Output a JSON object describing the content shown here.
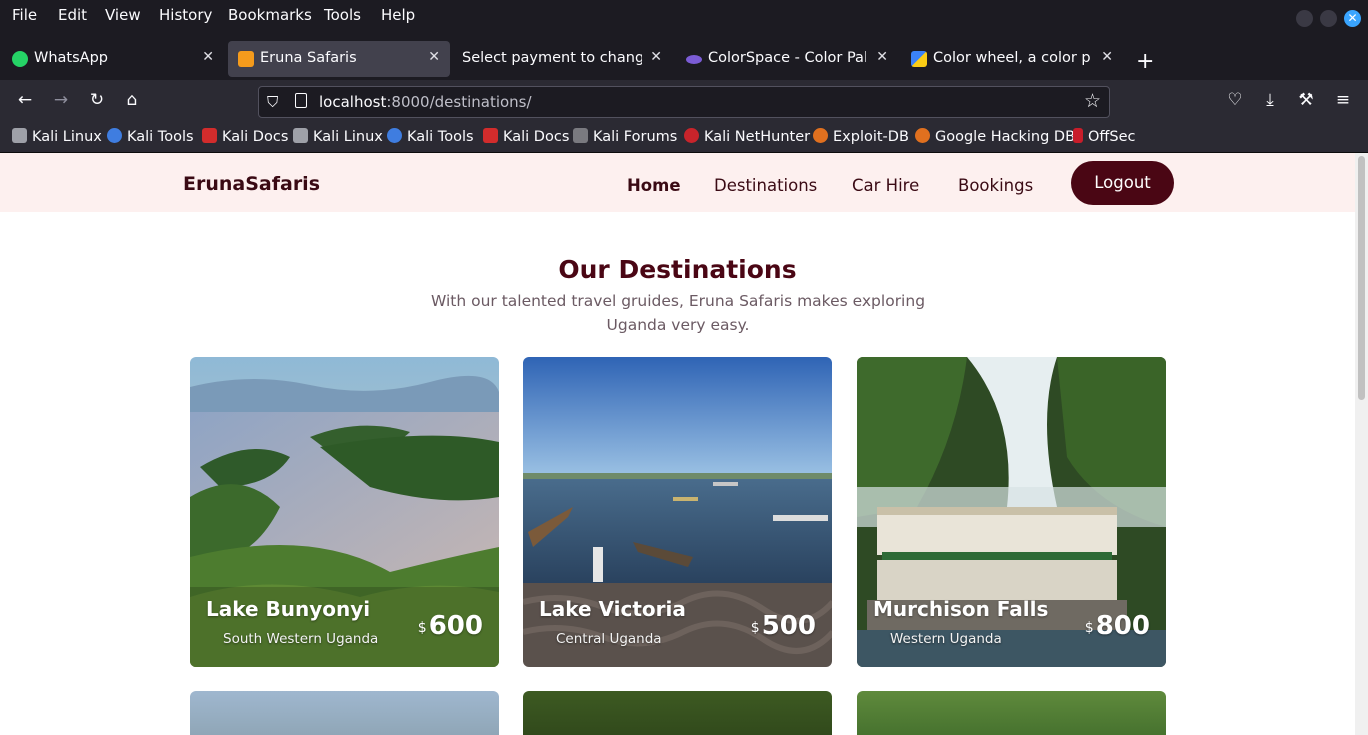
{
  "menubar": {
    "items": [
      "File",
      "Edit",
      "View",
      "History",
      "Bookmarks",
      "Tools",
      "Help"
    ]
  },
  "tabs": [
    {
      "label": "WhatsApp",
      "icon": "whatsapp-icon",
      "active": false
    },
    {
      "label": "Eruna Safaris",
      "icon": "site-favicon",
      "active": true
    },
    {
      "label": "Select payment to change | D",
      "icon": "",
      "active": false
    },
    {
      "label": "ColorSpace - Color Palett",
      "icon": "colorspace-icon",
      "active": false
    },
    {
      "label": "Color wheel, a color palet",
      "icon": "colorwheel-icon",
      "active": false
    }
  ],
  "address": {
    "host": "localhost",
    "rest": ":8000/destinations/"
  },
  "bookmarks": [
    {
      "label": "Kali Linux",
      "icon": "kali-dragon-icon"
    },
    {
      "label": "Kali Tools",
      "icon": "kali-tools-icon"
    },
    {
      "label": "Kali Docs",
      "icon": "kali-docs-icon"
    },
    {
      "label": "Kali Linux",
      "icon": "kali-dragon-icon"
    },
    {
      "label": "Kali Tools",
      "icon": "kali-tools-icon"
    },
    {
      "label": "Kali Docs",
      "icon": "kali-docs-icon"
    },
    {
      "label": "Kali Forums",
      "icon": "kali-forums-icon"
    },
    {
      "label": "Kali NetHunter",
      "icon": "nethunter-icon"
    },
    {
      "label": "Exploit-DB",
      "icon": "exploit-db-icon"
    },
    {
      "label": "Google Hacking DB",
      "icon": "ghdb-icon"
    },
    {
      "label": "OffSec",
      "icon": "offsec-icon"
    }
  ],
  "site": {
    "brand": "ErunaSafaris",
    "nav": {
      "home": "Home",
      "destinations": "Destinations",
      "car_hire": "Car Hire",
      "bookings": "Bookings",
      "logout": "Logout"
    },
    "heading": "Our Destinations",
    "subtext": "With our talented travel gruides, Eruna Safaris makes exploring Uganda very easy.",
    "destinations": [
      {
        "name": "Lake Bunyonyi",
        "location": "South Western Uganda",
        "currency": "$",
        "price": "600"
      },
      {
        "name": "Lake Victoria",
        "location": "Central Uganda",
        "currency": "$",
        "price": "500"
      },
      {
        "name": "Murchison Falls",
        "location": "Western Uganda",
        "currency": "$",
        "price": "800"
      }
    ]
  },
  "colors": {
    "accent": "#4a0614",
    "nav_bg": "#fdf0ef",
    "chrome_dark": "#1c1b22",
    "chrome_toolbar": "#2b2a33"
  }
}
